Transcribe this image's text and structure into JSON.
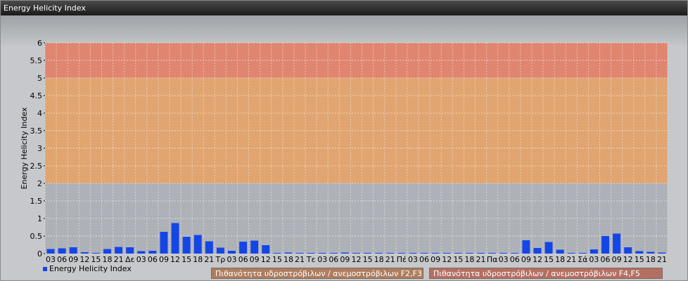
{
  "window": {
    "title": "Energy Helicity Index"
  },
  "legend": {
    "series_label": "Energy Helicity Index",
    "band1_label": "Πιθανότητα υδροστρόβιλων / ανεμοστρόβιλων F2,F3",
    "band2_label": "Πιθανότητα υδροστρόβιλων / ανεμοστρόβιλων F4,F5",
    "series_color": "#1446e6",
    "band1_color": "#ad7d5e",
    "band2_color": "#b46f63"
  },
  "chart_data": {
    "type": "bar",
    "ylabel": "Energy Helicity Index",
    "ylim": [
      0,
      6
    ],
    "yticks": [
      0,
      0.5,
      1,
      1.5,
      2,
      2.5,
      3,
      3.5,
      4,
      4.5,
      5,
      5.5,
      6
    ],
    "bands": [
      {
        "from": 0,
        "to": 2,
        "color": "#aeb1b7"
      },
      {
        "from": 2,
        "to": 5,
        "color": "#e0a571"
      },
      {
        "from": 5,
        "to": 6,
        "color": "#e08670"
      }
    ],
    "grid": true,
    "categories": [
      "03",
      "06",
      "09",
      "12",
      "15",
      "18",
      "21",
      "Δε",
      "03",
      "06",
      "09",
      "12",
      "15",
      "18",
      "21",
      "Τρ",
      "03",
      "06",
      "09",
      "12",
      "15",
      "18",
      "21",
      "Τε",
      "03",
      "06",
      "09",
      "12",
      "15",
      "18",
      "21",
      "Πέ",
      "03",
      "06",
      "09",
      "12",
      "15",
      "18",
      "21",
      "Πα",
      "03",
      "06",
      "09",
      "12",
      "15",
      "18",
      "21",
      "Σά",
      "03",
      "06",
      "09",
      "12",
      "15",
      "18",
      "21"
    ],
    "series": [
      {
        "name": "Energy Helicity Index",
        "values": [
          0.13,
          0.15,
          0.18,
          0.04,
          0.02,
          0.13,
          0.19,
          0.18,
          0.07,
          0.08,
          0.62,
          0.87,
          0.48,
          0.53,
          0.35,
          0.17,
          0.08,
          0.34,
          0.37,
          0.24,
          0.02,
          0.03,
          0.02,
          0.02,
          0.02,
          0.02,
          0.03,
          0.02,
          0.02,
          0.02,
          0.02,
          0.02,
          0.02,
          0.02,
          0.02,
          0.02,
          0.02,
          0.02,
          0.02,
          0.02,
          0.02,
          0.02,
          0.38,
          0.16,
          0.33,
          0.11,
          0.02,
          0.02,
          0.12,
          0.5,
          0.57,
          0.18,
          0.07,
          0.05,
          0.03
        ]
      }
    ]
  }
}
